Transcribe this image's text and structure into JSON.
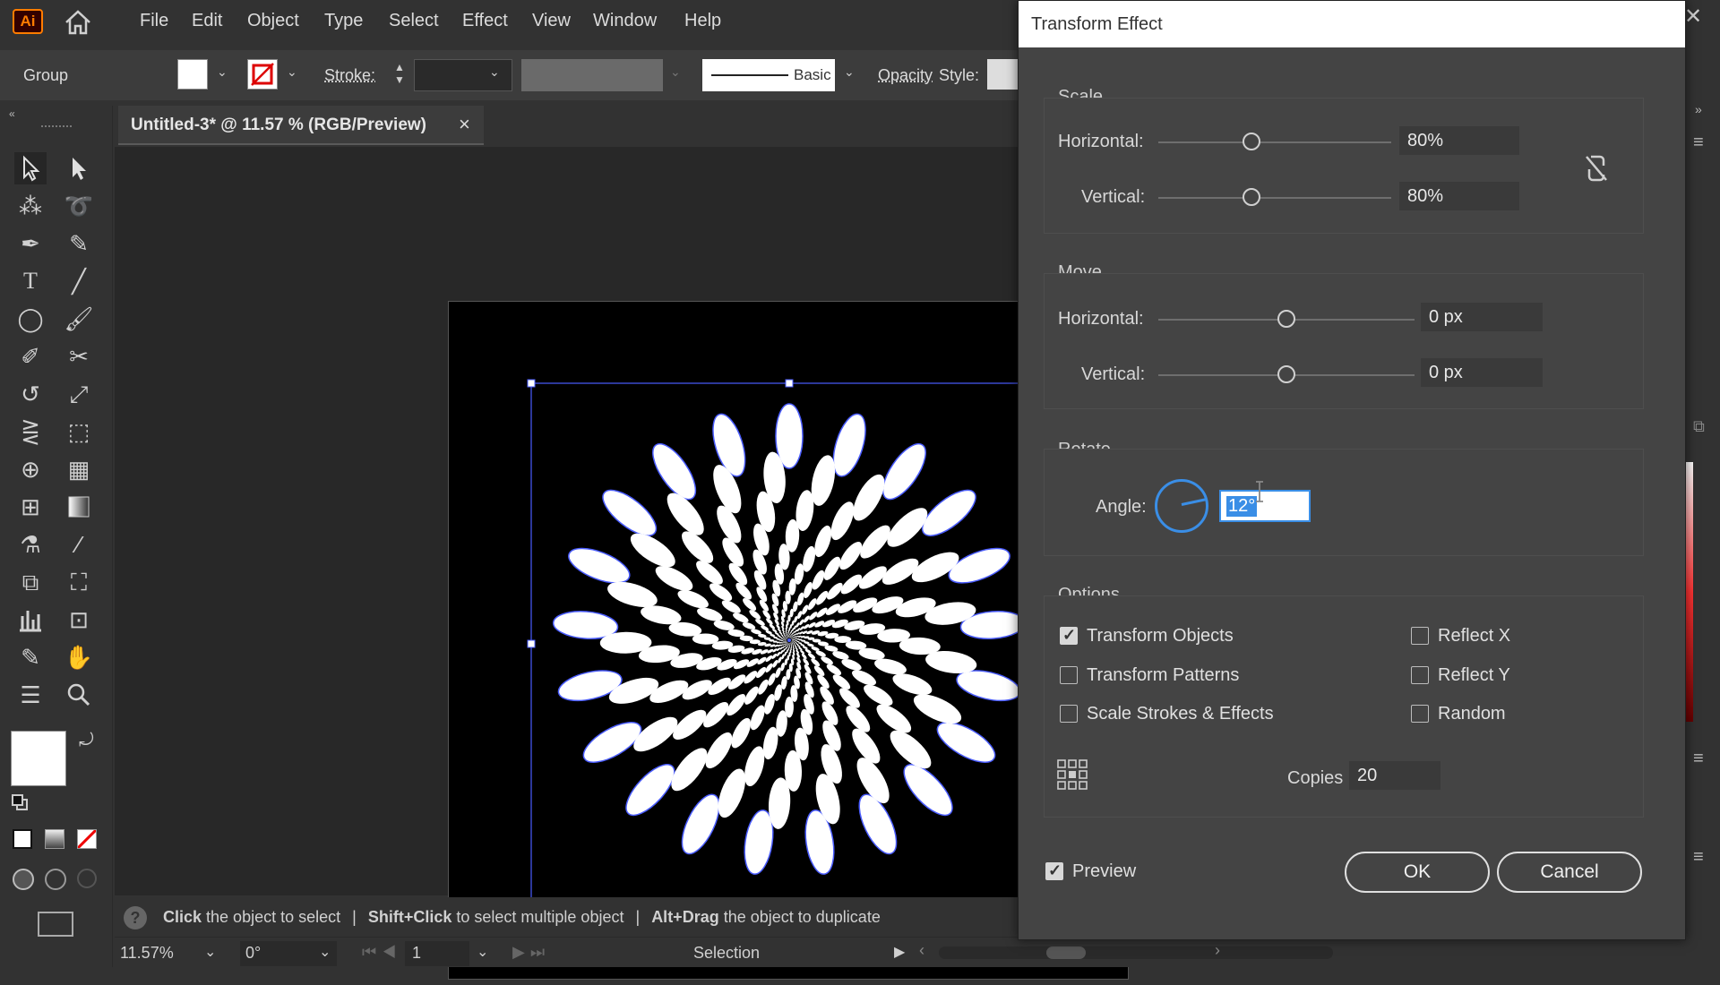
{
  "app": {
    "logo": "Ai"
  },
  "menu": [
    "File",
    "Edit",
    "Object",
    "Type",
    "Select",
    "Effect",
    "View",
    "Window",
    "Help"
  ],
  "control_bar": {
    "selection_type": "Group",
    "stroke_label": "Stroke:",
    "brush_label": "Basic",
    "opacity_label": "Opacity",
    "style_label": "Style:"
  },
  "document": {
    "tab_title": "Untitled-3* @ 11.57 % (RGB/Preview)",
    "close_glyph": "×"
  },
  "hint_bar": {
    "help_glyph": "?",
    "part1_bold": "Click",
    "part1_rest": " the object to select",
    "sep": "|",
    "part2_bold": "Shift+Click",
    "part2_rest": " to select multiple object",
    "part3_bold": "Alt+Drag",
    "part3_rest": " the object to duplicate"
  },
  "status_bar": {
    "zoom": "11.57%",
    "rotation": "0°",
    "artboard_num": "1",
    "tool_name": "Selection"
  },
  "dialog": {
    "title": "Transform Effect",
    "scale": {
      "section": "Scale",
      "horizontal_label": "Horizontal:",
      "horizontal_value": "80%",
      "horizontal_level": 0.4,
      "vertical_label": "Vertical:",
      "vertical_value": "80%",
      "vertical_level": 0.4
    },
    "move": {
      "section": "Move",
      "horizontal_label": "Horizontal:",
      "horizontal_value": "0 px",
      "horizontal_level": 0.5,
      "vertical_label": "Vertical:",
      "vertical_value": "0 px",
      "vertical_level": 0.5
    },
    "rotate": {
      "section": "Rotate",
      "angle_label": "Angle:",
      "angle_value": "12°"
    },
    "options": {
      "section": "Options",
      "transform_objects": {
        "label": "Transform Objects",
        "checked": true
      },
      "transform_patterns": {
        "label": "Transform Patterns",
        "checked": false
      },
      "scale_strokes": {
        "label": "Scale Strokes & Effects",
        "checked": false
      },
      "reflect_x": {
        "label": "Reflect X",
        "checked": false
      },
      "reflect_y": {
        "label": "Reflect Y",
        "checked": false
      },
      "random": {
        "label": "Random",
        "checked": false
      },
      "copies_label": "Copies",
      "copies_value": "20"
    },
    "preview": {
      "label": "Preview",
      "checked": true
    },
    "ok_label": "OK",
    "cancel_label": "Cancel"
  },
  "colors": {
    "selection_blue": "#4a5cff",
    "accent_blue": "#3a8ee6",
    "ai_orange": "#ff7c00"
  }
}
